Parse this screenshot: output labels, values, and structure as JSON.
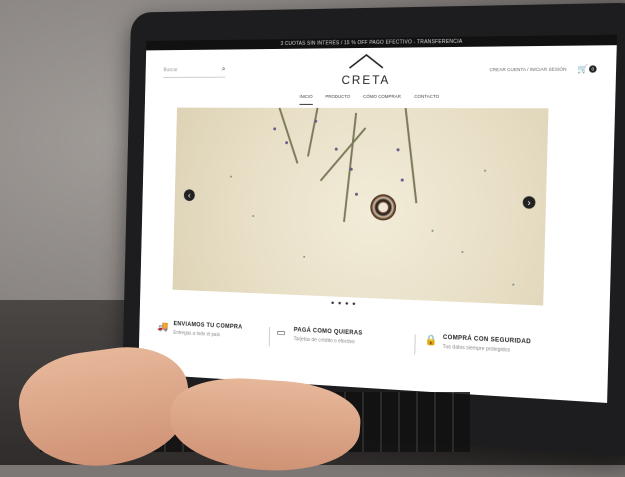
{
  "top_bar": {
    "text": "3 CUOTAS SIN INTERÉS / 15 % OFF PAGO EFECTIVO - TRANSFERENCIA"
  },
  "search": {
    "placeholder": "Buscar"
  },
  "logo": {
    "text": "CRETA"
  },
  "account": {
    "text": "CREAR CUENTA / INICIAR SESIÓN"
  },
  "cart": {
    "count": "0"
  },
  "nav": {
    "items": [
      "INICIO",
      "PRODUCTO",
      "CÓMO COMPRAR",
      "CONTACTO"
    ]
  },
  "slider": {
    "dots": "● ● ● ●"
  },
  "features": [
    {
      "title": "ENVIAMOS TU COMPRA",
      "subtitle": "Entregas a todo el país"
    },
    {
      "title": "PAGÁ COMO QUIERAS",
      "subtitle": "Tarjetas de crédito o efectivo"
    },
    {
      "title": "COMPRÁ CON SEGURIDAD",
      "subtitle": "Tus datos siempre protegidos"
    }
  ]
}
